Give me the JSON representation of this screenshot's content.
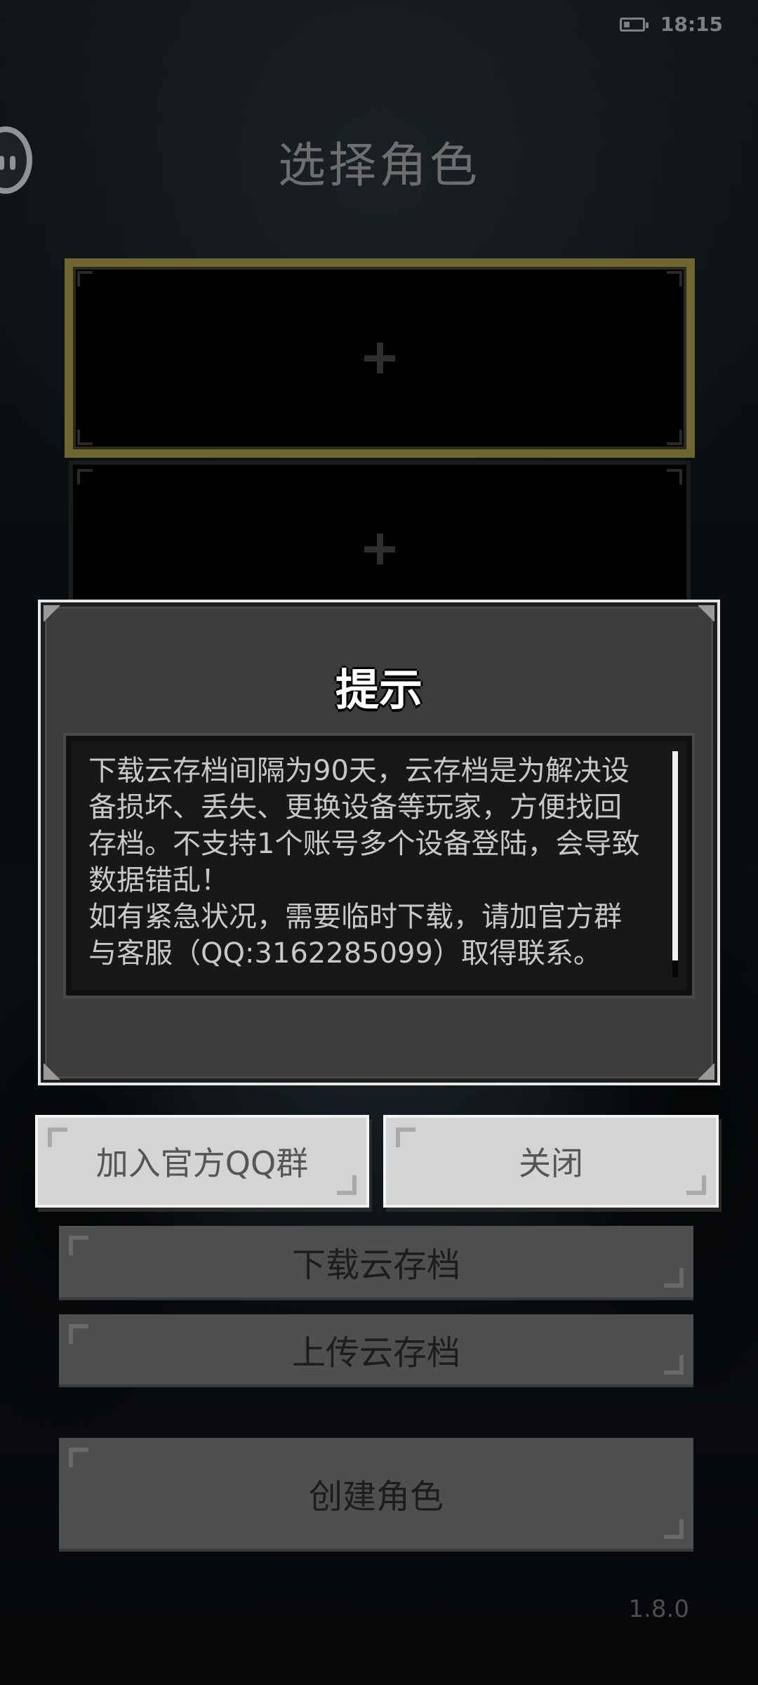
{
  "status_bar": {
    "time": "18:15"
  },
  "page_title": "选择角色",
  "role_slots": [
    {
      "icon": "plus-icon"
    },
    {
      "icon": "plus-icon"
    }
  ],
  "background_buttons": {
    "download_cloud_save": "下载云存档",
    "upload_cloud_save": "上传云存档",
    "create_role": "创建角色"
  },
  "version": "1.8.0",
  "dialog": {
    "title": "提示",
    "message": "下载云存档间隔为90天，云存档是为解决设\n备损坏、丢失、更换设备等玩家，方便找回\n存档。不支持1个账号多个设备登陆，会导致\n数据错乱！\n如有紧急状况，需要临时下载，请加官方群\n与客服（QQ:3162285099）取得联系。",
    "join_qq_group_button": "加入官方QQ群",
    "close_button": "关闭"
  },
  "colors": {
    "selected_slot_border": "#6f6631",
    "dialog_bg": "#3d3d3d",
    "dialog_button_bg": "#d4d4d4"
  }
}
